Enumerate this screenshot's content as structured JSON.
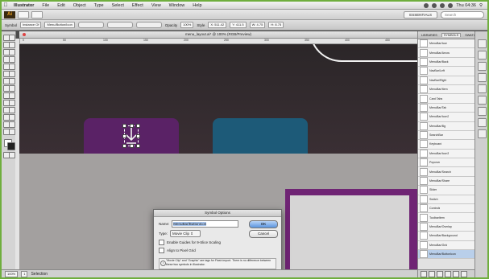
{
  "menubar": {
    "app_name": "Illustrator",
    "items": [
      "File",
      "Edit",
      "Object",
      "Type",
      "Select",
      "Effect",
      "View",
      "Window",
      "Help"
    ],
    "clock": "Thu 04:36"
  },
  "appbar": {
    "logo": "Ai",
    "workspace": "ESSENTIALS",
    "search_placeholder": "Search"
  },
  "controlbar": {
    "label_symbol": "Symbol",
    "field_instance": "Instance Of",
    "field_symbol_name": "Menu/Button/Icon",
    "label_opacity": "Opacity",
    "label_style": "Style",
    "field_x": "X: 511.42",
    "field_y": "Y: 411.5",
    "field_w": "W: 4.75",
    "field_h": "H: 8.75"
  },
  "document": {
    "title": "menu_layout.ai* @ 100% (RGB/Preview)",
    "ruler_ticks": [
      "0",
      "50",
      "100",
      "150",
      "200",
      "250",
      "300",
      "350",
      "400",
      "450"
    ]
  },
  "dialog": {
    "title": "Symbol Options",
    "name_label": "Name:",
    "name_value": "MenuBar/ButtonIcon",
    "type_label": "Type:",
    "type_value": "Movie Clip",
    "checkbox_9slice": "Enable Guides for 9-Slice Scaling",
    "checkbox_pixel": "Align to Pixel Grid",
    "ok_label": "OK",
    "cancel_label": "Cancel",
    "note": "\"Movie Clip\" and \"Graphic\" are tags for Flash import. There is no difference between these two symbols in Illustrator."
  },
  "statusbar": {
    "zoom": "100%",
    "page": "1",
    "label": "Selection"
  },
  "symbols_panel": {
    "tabs": [
      "LIBRARIES",
      "SYMBOLS",
      "SWATCHES"
    ],
    "active_tab": "SYMBOLS",
    "items": [
      "MenuBar/Icon",
      "MenuBar/Arrow",
      "MenuBar/Back",
      "NavBar/Left",
      "NavBar/Right",
      "MenuBar/Item",
      "Card Tabs",
      "MenuBar/Tab",
      "MenuBar/Icon2",
      "MenuBar/Bg",
      "SearchBar",
      "Keyboard",
      "MenuBar/Icon3",
      "Popover",
      "MenuBar/Search",
      "MenuBar/Share",
      "Slider",
      "Switch",
      "Controls",
      "ToolbarItem",
      "MenuBar/Overlay",
      "MenuBar/Background",
      "MenuBar/Grid",
      "MenuBar/ButtonIcon"
    ]
  },
  "colors": {
    "purple_tab": "#5a2266",
    "blue_tab": "#1d5a78",
    "canvas_dark": "#2b2628",
    "canvas_gray": "#a3a09f"
  }
}
